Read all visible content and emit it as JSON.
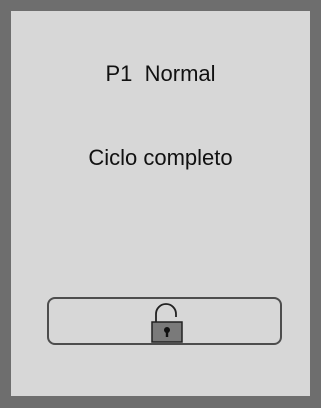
{
  "display": {
    "program_id": "P1",
    "program_mode": "Normal",
    "status": "Ciclo completo"
  },
  "lock_button": {
    "icon": "unlocked-padlock-icon",
    "state": "unlocked"
  },
  "colors": {
    "frame": "#6e6e6e",
    "screen": "#d7d7d7",
    "text": "#111111",
    "button_border": "#4d4d4d",
    "lock_body": "#7a7a7a"
  }
}
